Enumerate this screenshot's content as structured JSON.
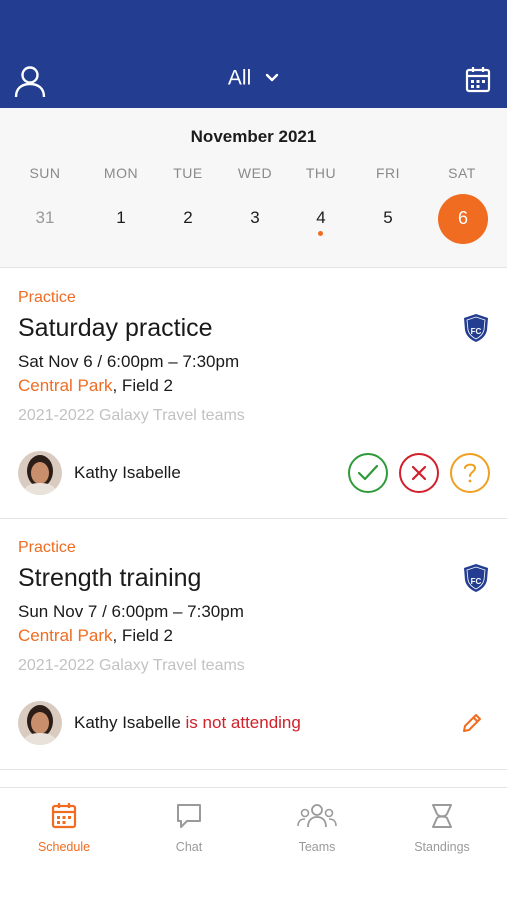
{
  "header": {
    "filter_label": "All",
    "profile_icon": "user-icon",
    "calendar_icon": "calendar-icon",
    "bg_color": "#233d91"
  },
  "calendar": {
    "month_label": "November 2021",
    "weekdays": [
      "SUN",
      "MON",
      "TUE",
      "WED",
      "THU",
      "FRI",
      "SAT"
    ],
    "days": [
      "31",
      "1",
      "2",
      "3",
      "4",
      "5",
      "6"
    ],
    "selected_day": "6",
    "accent_color": "#ef6c21"
  },
  "events": [
    {
      "type": "Practice",
      "title": "Saturday practice",
      "time": "Sat Nov 6 / 6:00pm – 7:30pm",
      "location": "Central Park",
      "field": ", Field 2",
      "team": "2021-2022 Galaxy Travel teams",
      "person": "Kathy Isabelle",
      "status": ""
    },
    {
      "type": "Practice",
      "title": "Strength training",
      "time": "Sun Nov 7 / 6:00pm – 7:30pm",
      "location": "Central Park",
      "field": ", Field 2",
      "team": "2021-2022 Galaxy Travel teams",
      "person": "Kathy Isabelle",
      "status": "is not attending"
    }
  ],
  "tabs": [
    {
      "label": "Schedule",
      "icon": "calendar-icon",
      "active": true
    },
    {
      "label": "Chat",
      "icon": "chat-bubble-icon",
      "active": false
    },
    {
      "label": "Teams",
      "icon": "people-icon",
      "active": false
    },
    {
      "label": "Standings",
      "icon": "trophy-icon",
      "active": false
    }
  ]
}
